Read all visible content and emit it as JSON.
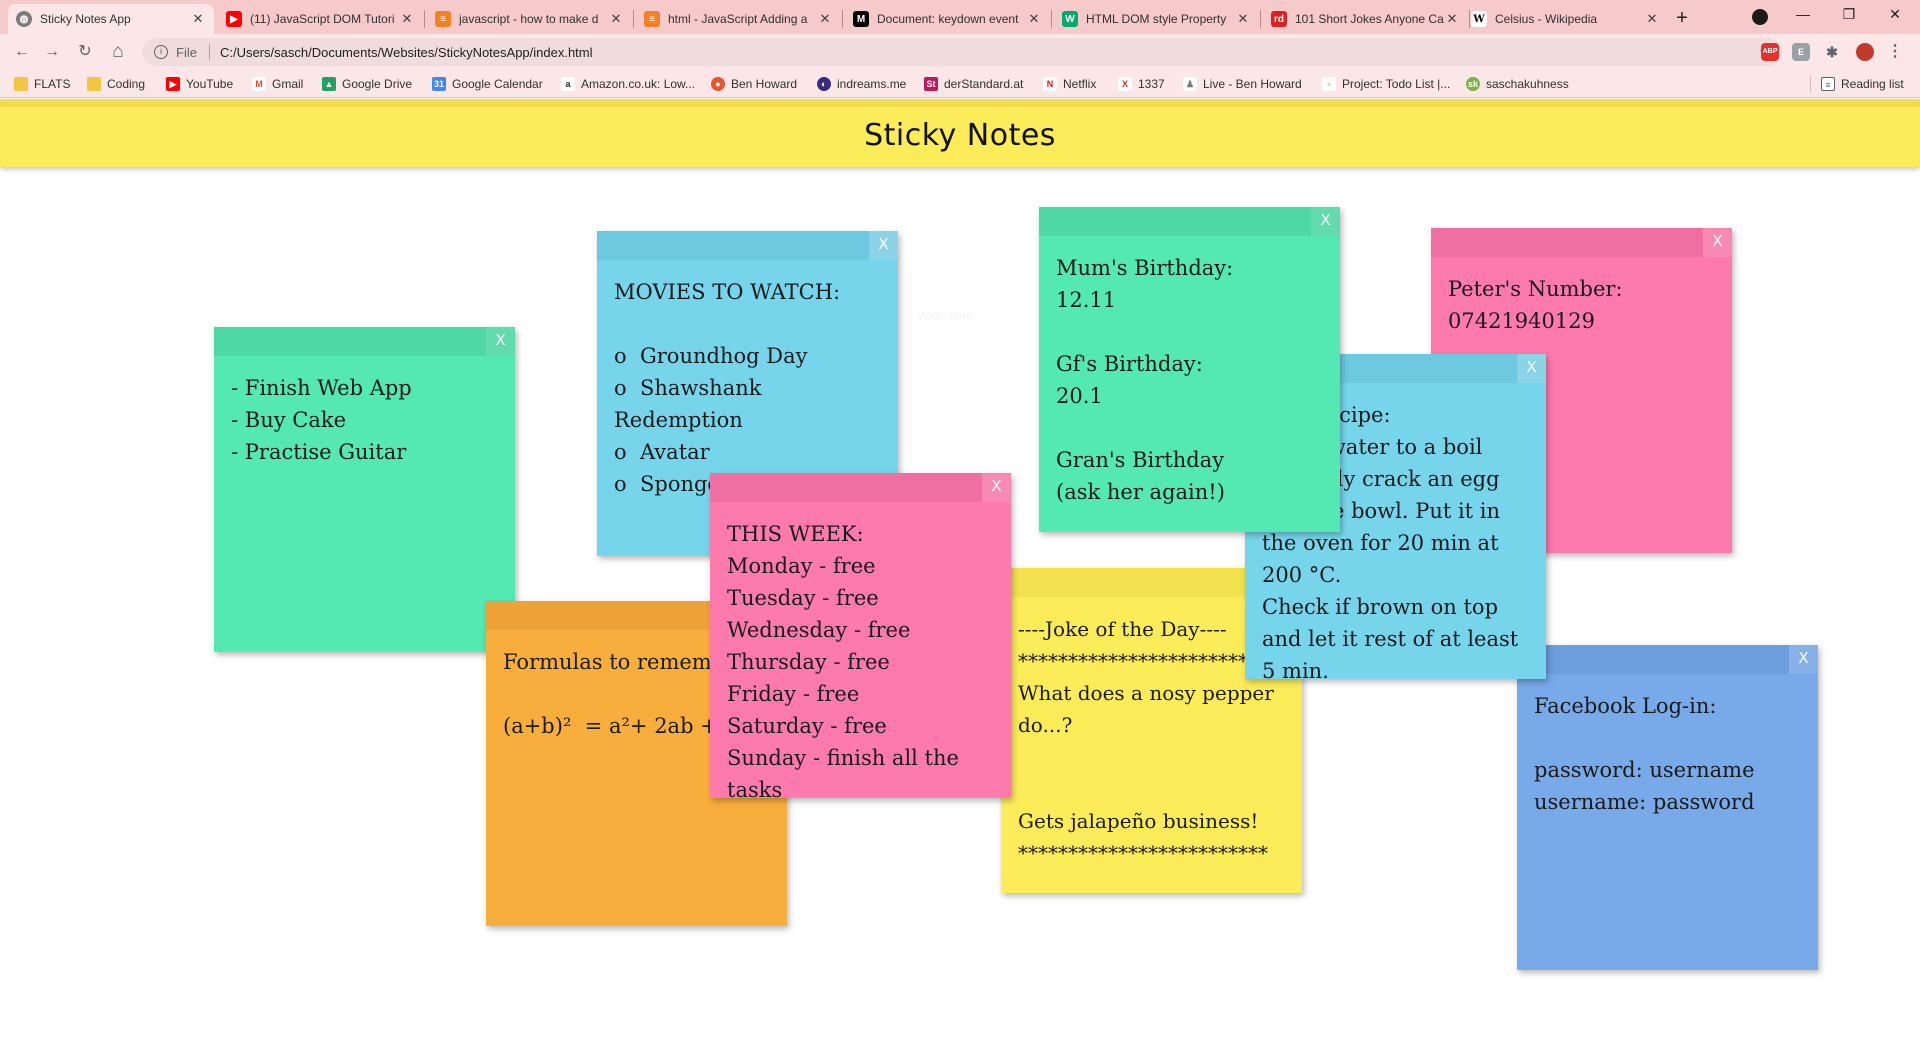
{
  "browser": {
    "tabs": [
      {
        "title": "Sticky Notes App",
        "icon": "globe-icon",
        "color": "#5f6368",
        "active": true
      },
      {
        "title": "(11) JavaScript DOM Tutori",
        "icon": "youtube-icon",
        "color": "#ff0000"
      },
      {
        "title": "javascript - how to make d",
        "icon": "stackoverflow-icon",
        "color": "#f48024"
      },
      {
        "title": "html - JavaScript Adding a",
        "icon": "stackoverflow-icon",
        "color": "#f48024"
      },
      {
        "title": "Document: keydown event",
        "icon": "mdn-icon",
        "color": "#000000"
      },
      {
        "title": "HTML DOM style Property",
        "icon": "w3schools-icon",
        "color": "#04aa6d"
      },
      {
        "title": "101 Short Jokes Anyone Ca",
        "icon": "rd-icon",
        "color": "#e02020"
      },
      {
        "title": "Celsius - Wikipedia",
        "icon": "wikipedia-icon",
        "color": "#ffffff"
      }
    ],
    "new_tab": "+",
    "window": {
      "minimize": "—",
      "restore": "❐",
      "close": "✕"
    },
    "address": {
      "info": "i",
      "scheme_label": "File",
      "url": "C:/Users/sasch/Documents/Websites/StickyNotesApp/index.html",
      "star": "☆"
    },
    "nav": {
      "back": "←",
      "forward": "→",
      "reload": "↻",
      "home": "⌂"
    },
    "extensions": [
      {
        "name": "adblock-icon",
        "label": "ABP",
        "color": "#e4312b"
      },
      {
        "name": "extension-icon",
        "label": "E",
        "color": "#9aa0a6"
      },
      {
        "name": "puzzle-icon",
        "label": "✱",
        "color": "#5f6368"
      },
      {
        "name": "profile-avatar-icon",
        "label": "",
        "color": "#c0392b"
      }
    ],
    "menu": "⋮",
    "bookmarks": [
      {
        "label": "FLATS",
        "icon": "folder-icon",
        "color": "#f4c542"
      },
      {
        "label": "Coding",
        "icon": "folder-icon",
        "color": "#f4c542"
      },
      {
        "label": "YouTube",
        "icon": "youtube-icon",
        "color": "#ff0000"
      },
      {
        "label": "Gmail",
        "icon": "gmail-icon",
        "color": "#ea4335"
      },
      {
        "label": "Google Drive",
        "icon": "drive-icon",
        "color": "#1fa463"
      },
      {
        "label": "Google Calendar",
        "icon": "calendar-icon",
        "color": "#4285f4"
      },
      {
        "label": "Amazon.co.uk: Low...",
        "icon": "amazon-icon",
        "color": "#222222"
      },
      {
        "label": "Ben Howard",
        "icon": "ben-howard-icon",
        "color": "#e2572c"
      },
      {
        "label": "indreams.me",
        "icon": "indreams-icon",
        "color": "#3b2c7a"
      },
      {
        "label": "derStandard.at",
        "icon": "derstandard-icon",
        "color": "#c2185b"
      },
      {
        "label": "Netflix",
        "icon": "netflix-icon",
        "color": "#e50914"
      },
      {
        "label": "1337",
        "icon": "x-icon",
        "color": "#d93025"
      },
      {
        "label": "Live - Ben Howard",
        "icon": "person-icon",
        "color": "#777777"
      },
      {
        "label": "Project: Todo List |...",
        "icon": "odin-icon",
        "color": "#c4a053"
      },
      {
        "label": "saschakuhness",
        "icon": "sk-icon",
        "color": "#7cb342"
      }
    ],
    "reading_list": "Reading list"
  },
  "page": {
    "title": "Sticky Notes",
    "ghost_text": "Write here"
  },
  "notes": [
    {
      "color": "green",
      "close": "X",
      "text": "- Finish Web App\n- Buy Cake\n- Practise Guitar"
    },
    {
      "color": "blue",
      "close": "X",
      "text": "MOVIES TO WATCH:\n\no  Groundhog Day\no  Shawshank Redemption\no  Avatar\no  Sponge on the Run"
    },
    {
      "color": "green",
      "close": "X",
      "text": "Mum's Birthday:\n12.11\n\nGf's Birthday:\n20.1\n\nGran's Birthday\n(ask her again!)"
    },
    {
      "color": "pink",
      "close": "X",
      "text": "Peter's Number:\n07421940129"
    },
    {
      "color": "orange",
      "close": "X",
      "text": "Formulas to remember:\n\n(a+b)²  = a²+ 2ab + b²"
    },
    {
      "color": "pink",
      "close": "X",
      "text": "THIS WEEK:\nMonday - free\nTuesday - free\nWednesday - free\nThursday - free\nFriday - free\nSaturday - free\nSunday - finish all the tasks"
    },
    {
      "color": "yellow",
      "close": "X",
      "text": "----Joke of the Day----\n*************************\nWhat does a nosy pepper do...?\n\n\nGets jalapeño business!\n*************************"
    },
    {
      "color": "blue",
      "close": "X",
      "text": "Egg Recipe:\nBring water to a boil\ncarefully crack an egg into the bowl. Put it in the oven for 20 min at 200 °C.\nCheck if brown on top and let it rest of at least 5 min."
    },
    {
      "color": "dblue",
      "close": "X",
      "text": "Facebook Log-in:\n\npassword: username\nusername: password"
    }
  ]
}
